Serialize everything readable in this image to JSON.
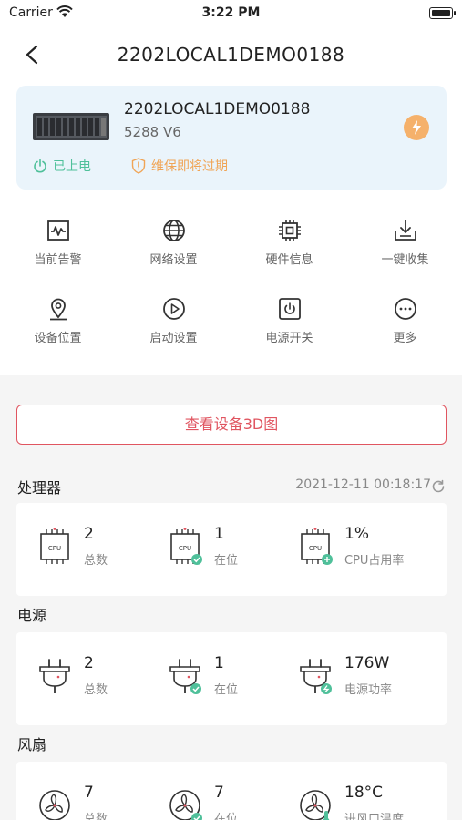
{
  "status_bar": {
    "carrier": "Carrier",
    "time": "3:22 PM"
  },
  "nav": {
    "title": "2202LOCAL1DEMO0188"
  },
  "device": {
    "name": "2202LOCAL1DEMO0188",
    "model": "5288 V6",
    "power_status": "已上电",
    "warranty_status": "维保即将过期"
  },
  "actions": [
    {
      "label": "当前告警",
      "icon": "alarm-icon"
    },
    {
      "label": "网络设置",
      "icon": "globe-icon"
    },
    {
      "label": "硬件信息",
      "icon": "chip-icon"
    },
    {
      "label": "一键收集",
      "icon": "download-icon"
    },
    {
      "label": "设备位置",
      "icon": "location-icon"
    },
    {
      "label": "启动设置",
      "icon": "play-icon"
    },
    {
      "label": "电源开关",
      "icon": "power-icon"
    },
    {
      "label": "更多",
      "icon": "more-icon"
    }
  ],
  "view_3d_label": "查看设备3D图",
  "processor": {
    "title": "处理器",
    "timestamp": "2021-12-11 00:18:17",
    "stats": [
      {
        "value": "2",
        "label": "总数"
      },
      {
        "value": "1",
        "label": "在位"
      },
      {
        "value": "1%",
        "label": "CPU占用率"
      }
    ]
  },
  "power": {
    "title": "电源",
    "stats": [
      {
        "value": "2",
        "label": "总数"
      },
      {
        "value": "1",
        "label": "在位"
      },
      {
        "value": "176W",
        "label": "电源功率"
      }
    ]
  },
  "fan": {
    "title": "风扇",
    "stats": [
      {
        "value": "7",
        "label": "总数"
      },
      {
        "value": "7",
        "label": "在位"
      },
      {
        "value": "18°C",
        "label": "进风口温度"
      }
    ]
  },
  "colors": {
    "accent_red": "#e05560",
    "ok_green": "#4fc09a",
    "warn_orange": "#f0a455",
    "card_bg": "#eaf4fb"
  }
}
